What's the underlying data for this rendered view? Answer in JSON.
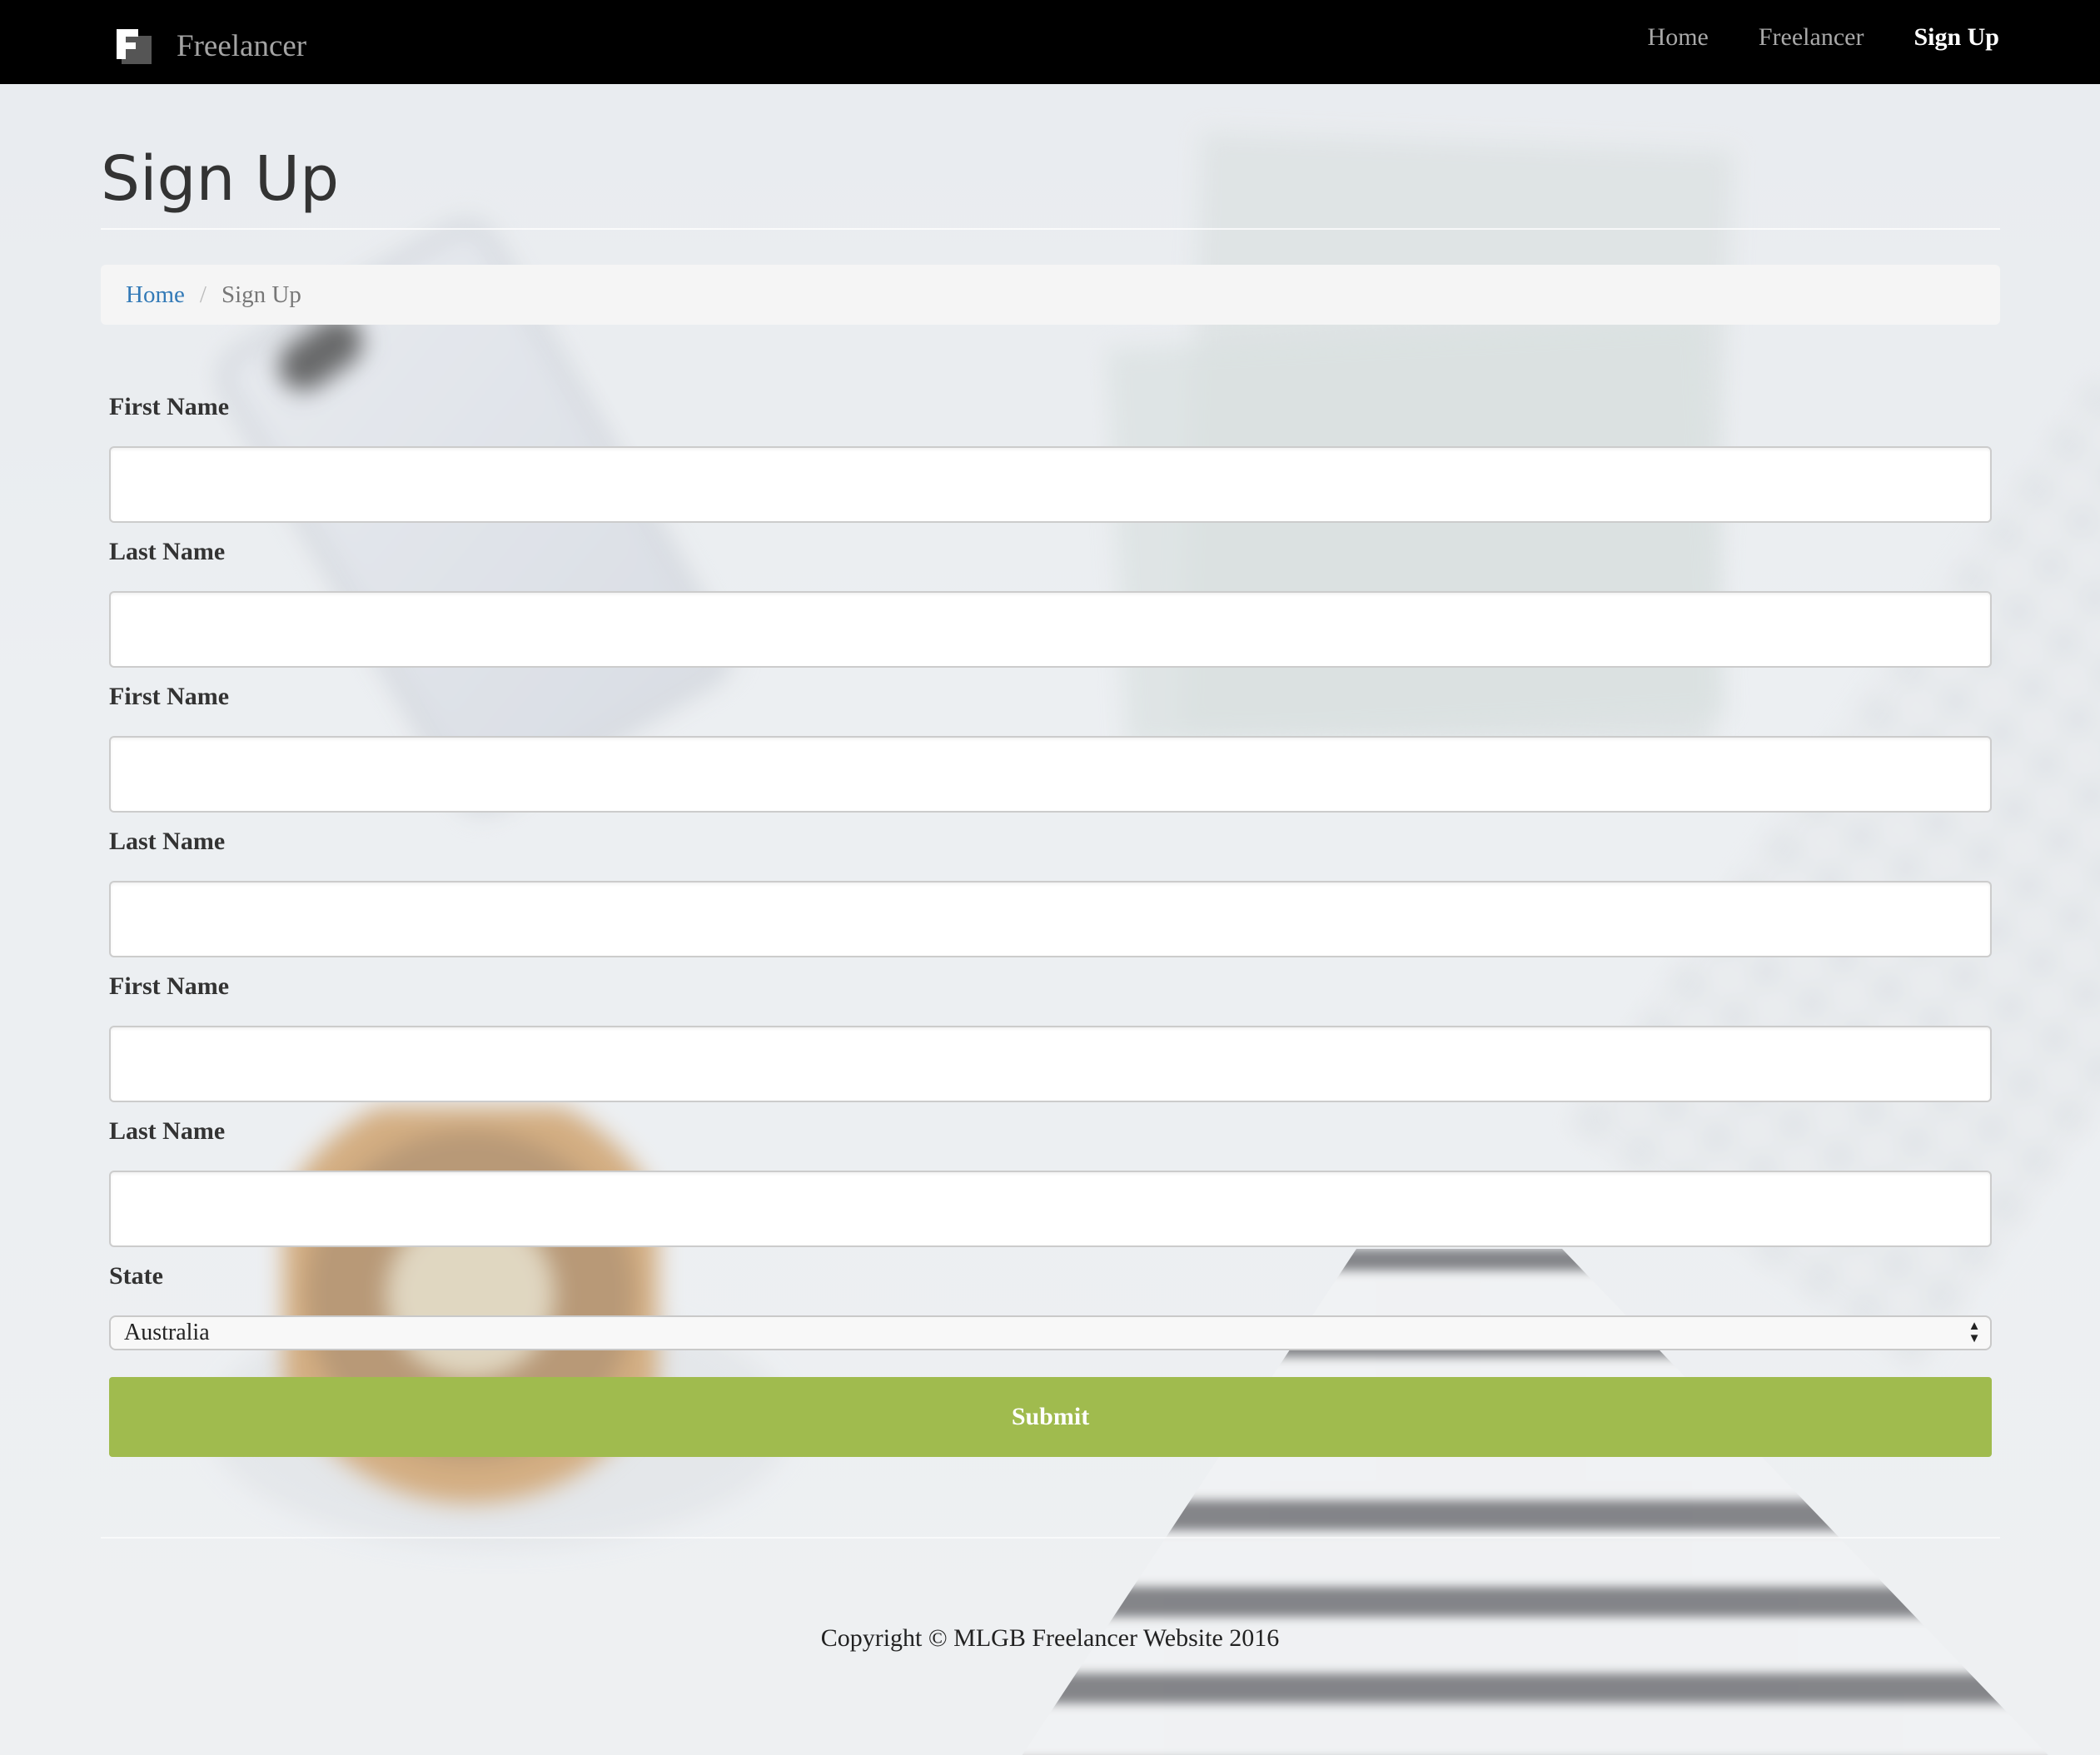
{
  "navbar": {
    "brand": "Freelancer",
    "links": [
      "Home",
      "Freelancer",
      "Sign Up"
    ]
  },
  "page": {
    "title": "Sign Up"
  },
  "breadcrumb": {
    "home": "Home",
    "separator": "/",
    "current": "Sign Up"
  },
  "form": {
    "fields": [
      {
        "label": "First Name",
        "value": ""
      },
      {
        "label": "Last Name",
        "value": ""
      },
      {
        "label": "First Name",
        "value": ""
      },
      {
        "label": "Last Name",
        "value": ""
      },
      {
        "label": "First Name",
        "value": ""
      },
      {
        "label": "Last Name",
        "value": ""
      }
    ],
    "state_label": "State",
    "state_value": "Australia",
    "submit_label": "Submit"
  },
  "footer": {
    "copyright": "Copyright © MLGB Freelancer Website 2016"
  },
  "colors": {
    "navbar_bg": "#000000",
    "submit_bg": "#a0bb4e",
    "link": "#337ab7"
  }
}
